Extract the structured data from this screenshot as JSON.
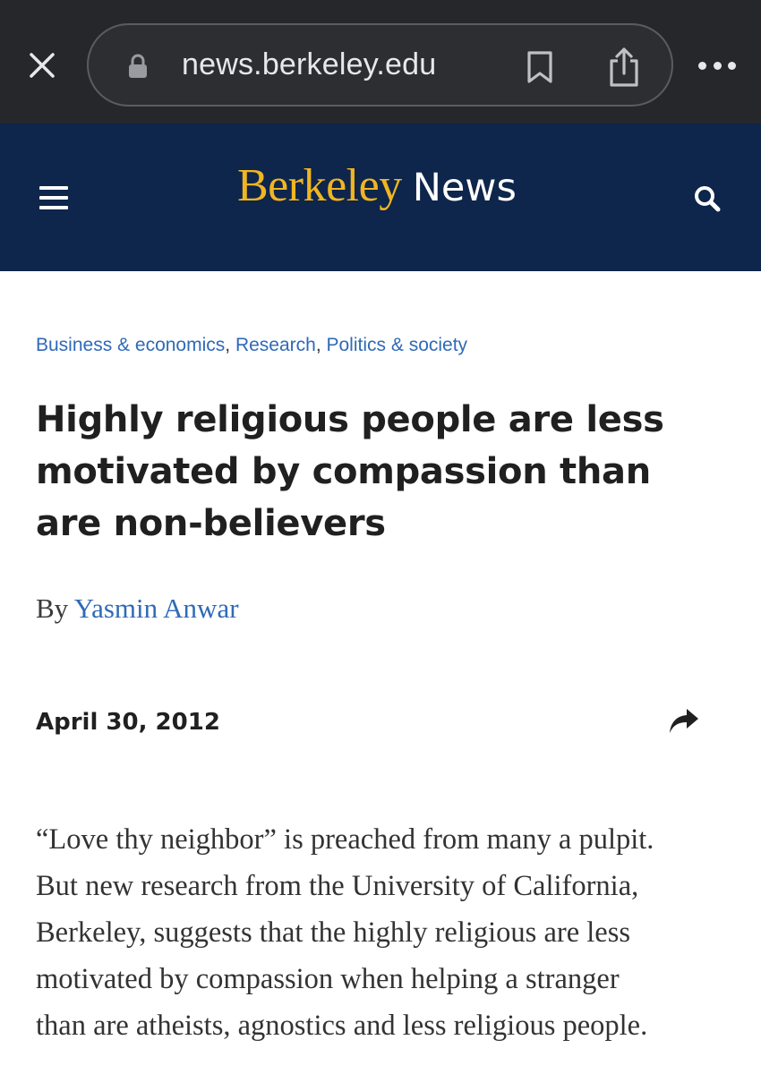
{
  "browser": {
    "url": "news.berkeley.edu",
    "icons": {
      "close": "close-icon",
      "lock": "lock-icon",
      "bookmark": "bookmark-icon",
      "share": "share-icon",
      "more": "more-icon"
    }
  },
  "header": {
    "logo_primary": "Berkeley",
    "logo_secondary": "News",
    "icons": {
      "menu": "hamburger-menu-icon",
      "search": "search-icon"
    },
    "colors": {
      "background": "#0e254c",
      "gold": "#f1b521"
    }
  },
  "article": {
    "categories": [
      {
        "label": "Business & economics"
      },
      {
        "label": "Research"
      },
      {
        "label": "Politics & society"
      }
    ],
    "category_separator": ", ",
    "headline_lines": [
      "Highly religious people are less",
      "motivated by compassion than",
      "are non-believers"
    ],
    "byline_prefix": "By",
    "author": "Yasmin Anwar",
    "date": "April 30, 2012",
    "share_icon": "share-arrow-icon",
    "body_lines": [
      "“Love thy neighbor” is preached from many a pulpit.",
      "But new research from the University of California,",
      "Berkeley, suggests that the highly religious are less",
      "motivated by compassion when helping a stranger",
      "than are atheists, agnostics and less religious people."
    ],
    "colors": {
      "link": "#2f6ab7",
      "text": "#202020"
    }
  }
}
